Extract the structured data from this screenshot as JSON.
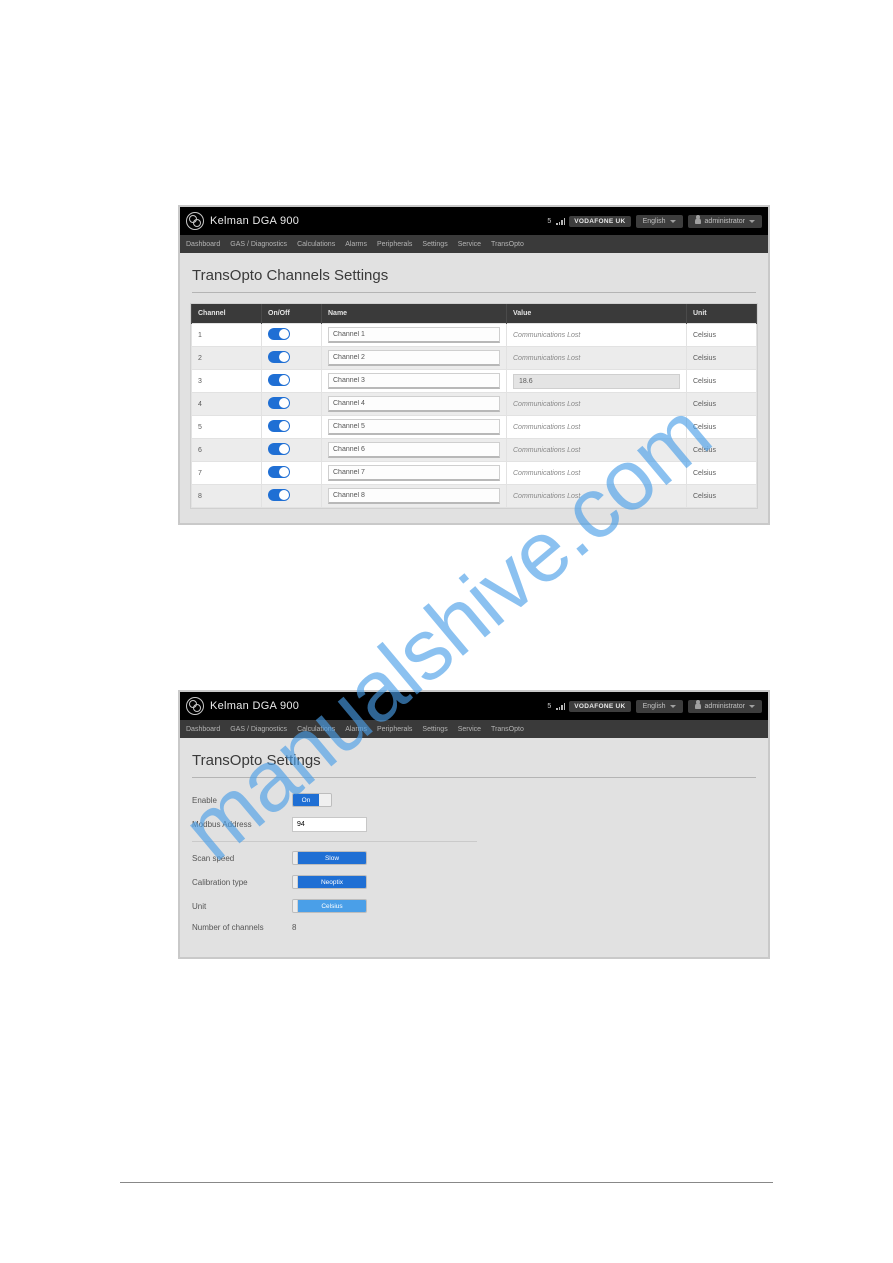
{
  "watermark": "manualshive.com",
  "header": {
    "brand": "Kelman DGA 900",
    "signal_strength": "5",
    "carrier": "VODAFONE UK",
    "language_label": "English",
    "user_label": "administrator"
  },
  "nav": {
    "items": [
      "Dashboard",
      "GAS / Diagnostics",
      "Calculations",
      "Alarms",
      "Peripherals",
      "Settings",
      "Service",
      "TransOpto"
    ]
  },
  "page1": {
    "title": "TransOpto Channels Settings",
    "columns": {
      "channel": "Channel",
      "onoff": "On/Off",
      "name": "Name",
      "value": "Value",
      "unit": "Unit"
    },
    "rows": [
      {
        "ch": "1",
        "on": true,
        "name": "Channel 1",
        "value_lost": "Communications Lost",
        "value_num": null,
        "unit": "Celsius"
      },
      {
        "ch": "2",
        "on": true,
        "name": "Channel 2",
        "value_lost": "Communications Lost",
        "value_num": null,
        "unit": "Celsius"
      },
      {
        "ch": "3",
        "on": true,
        "name": "Channel 3",
        "value_lost": null,
        "value_num": "18.6",
        "unit": "Celsius"
      },
      {
        "ch": "4",
        "on": true,
        "name": "Channel 4",
        "value_lost": "Communications Lost",
        "value_num": null,
        "unit": "Celsius"
      },
      {
        "ch": "5",
        "on": true,
        "name": "Channel 5",
        "value_lost": "Communications Lost",
        "value_num": null,
        "unit": "Celsius"
      },
      {
        "ch": "6",
        "on": true,
        "name": "Channel 6",
        "value_lost": "Communications Lost",
        "value_num": null,
        "unit": "Celsius"
      },
      {
        "ch": "7",
        "on": true,
        "name": "Channel 7",
        "value_lost": "Communications Lost",
        "value_num": null,
        "unit": "Celsius"
      },
      {
        "ch": "8",
        "on": true,
        "name": "Channel 8",
        "value_lost": "Communications Lost",
        "value_num": null,
        "unit": "Celsius"
      }
    ]
  },
  "page2": {
    "title": "TransOpto Settings",
    "fields": {
      "enable_label": "Enable",
      "enable_value": "On",
      "modbus_label": "Modbus Address",
      "modbus_value": "94",
      "scanspeed_label": "Scan speed",
      "scanspeed_value": "Slow",
      "calibration_label": "Calibration type",
      "calibration_value": "Neoptix",
      "unit_label": "Unit",
      "unit_value": "Celsius",
      "numch_label": "Number of channels",
      "numch_value": "8"
    }
  }
}
